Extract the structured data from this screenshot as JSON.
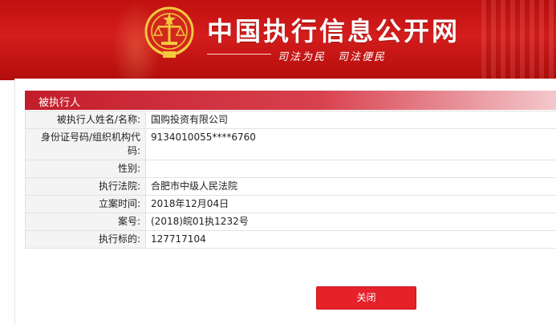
{
  "header": {
    "title": "中国执行信息公开网",
    "slogan": "司法为民　司法便民",
    "emblem_icon": "court-emblem-icon",
    "colors": {
      "banner_red": "#c0100f",
      "accent_red": "#e5212a"
    }
  },
  "panel": {
    "heading": "被执行人",
    "rows": [
      {
        "label": "被执行人姓名/名称:",
        "value": "国购投资有限公司"
      },
      {
        "label": "身份证号码/组织机构代码:",
        "value": "9134010055****6760"
      },
      {
        "label": "性别:",
        "value": ""
      },
      {
        "label": "执行法院:",
        "value": "合肥市中级人民法院"
      },
      {
        "label": "立案时间:",
        "value": "2018年12月04日"
      },
      {
        "label": "案号:",
        "value": "(2018)皖01执1232号"
      },
      {
        "label": "执行标的:",
        "value": "127717104"
      }
    ],
    "close_label": "关闭"
  }
}
